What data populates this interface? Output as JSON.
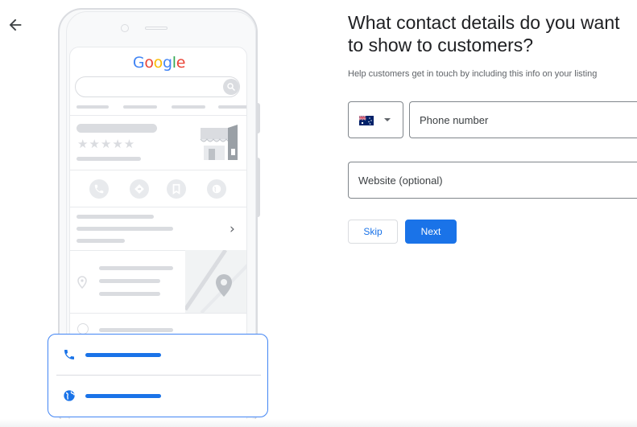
{
  "header": {
    "back_icon": "arrow-left-icon"
  },
  "illustration": {
    "brand_logo": "Google",
    "logo_colors": [
      "#4285f4",
      "#ea4335",
      "#fbbc05",
      "#4285f4",
      "#34a853",
      "#ea4335"
    ],
    "action_icons": [
      "phone-icon",
      "directions-icon",
      "bookmark-icon",
      "globe-icon"
    ],
    "highlight_icons": [
      "phone-icon",
      "globe-icon"
    ],
    "highlight_color": "#1a73e8"
  },
  "form": {
    "title": "What contact details do you want to show to customers?",
    "subtitle": "Help customers get in touch by including this info on your listing",
    "country": {
      "selected": "Australia",
      "icon": "australia-flag-icon"
    },
    "phone": {
      "placeholder": "Phone number",
      "value": ""
    },
    "website": {
      "placeholder": "Website (optional)",
      "value": ""
    },
    "skip_label": "Skip",
    "next_label": "Next"
  },
  "colors": {
    "primary": "#1a73e8",
    "border": "#80868b",
    "muted": "#dadce0"
  }
}
